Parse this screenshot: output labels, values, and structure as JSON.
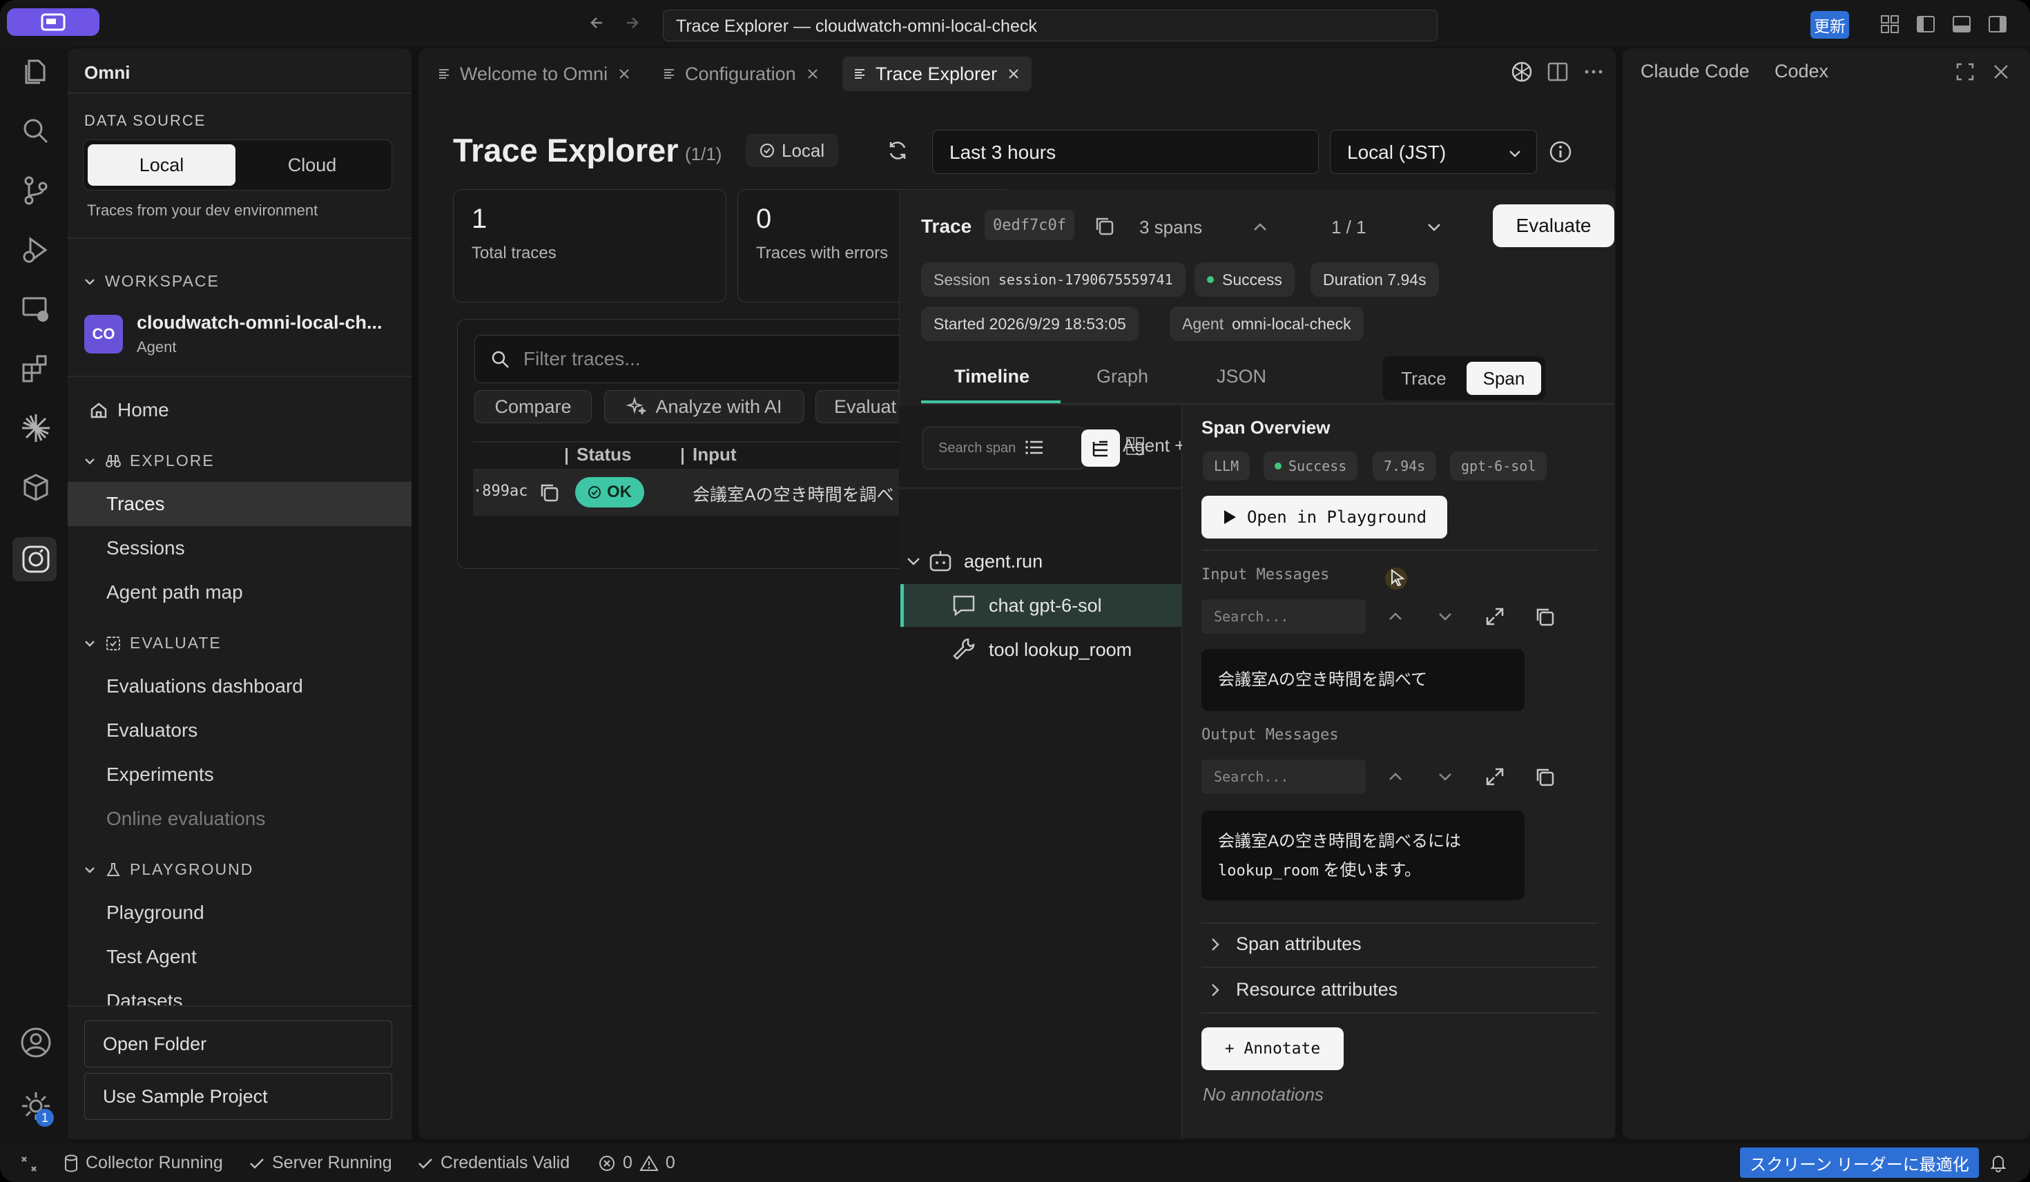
{
  "window": {
    "title": "Trace Explorer — cloudwatch-omni-local-check",
    "update_label": "更新"
  },
  "sidebar": {
    "app_name": "Omni",
    "data_source_heading": "DATA SOURCE",
    "local_label": "Local",
    "cloud_label": "Cloud",
    "data_source_hint": "Traces from your dev environment",
    "workspace_heading": "WORKSPACE",
    "workspace_avatar": "CO",
    "workspace_name": "cloudwatch-omni-local-ch...",
    "workspace_kind": "Agent",
    "home_label": "Home",
    "explore_heading": "EXPLORE",
    "explore_items": [
      "Traces",
      "Sessions",
      "Agent path map"
    ],
    "evaluate_heading": "EVALUATE",
    "evaluate_items": [
      "Evaluations dashboard",
      "Evaluators",
      "Experiments",
      "Online evaluations"
    ],
    "playground_heading": "PLAYGROUND",
    "playground_items": [
      "Playground",
      "Test Agent",
      "Datasets"
    ],
    "open_folder_label": "Open Folder",
    "sample_project_label": "Use Sample Project",
    "settings_badge": "1"
  },
  "tabs": [
    {
      "label": "Welcome to Omni"
    },
    {
      "label": "Configuration"
    },
    {
      "label": "Trace Explorer"
    }
  ],
  "explorer": {
    "title": "Trace Explorer",
    "count": "(1/1)",
    "local_badge": "Local",
    "time_range": "Last 3 hours",
    "timezone": "Local (JST)",
    "total_traces_value": "1",
    "total_traces_label": "Total traces",
    "errors_value": "0",
    "errors_label": "Traces with errors",
    "filter_placeholder": "Filter traces...",
    "compare_label": "Compare",
    "analyze_label": "Analyze with AI",
    "evaluate_partial": "Evaluat",
    "col_status": "Status",
    "col_input": "Input",
    "row_id": "·899ac",
    "row_status": "OK",
    "row_input": "会議室Aの空き時間を調べ"
  },
  "trace": {
    "label": "Trace",
    "id": "0edf7c0f",
    "spans": "3 spans",
    "pager": "1 / 1",
    "evaluate_label": "Evaluate",
    "session_key": "Session",
    "session_value": "session-1790675559741",
    "status": "Success",
    "duration": "Duration 7.94s",
    "started": "Started 2026/9/29 18:53:05",
    "agent_key": "Agent",
    "agent_value": "omni-local-check",
    "view_tabs": [
      "Timeline",
      "Graph",
      "JSON"
    ],
    "mode_trace": "Trace",
    "mode_span": "Span",
    "span_search_placeholder": "Search span",
    "agent_toggle_partial": "Agent +",
    "tree": [
      "agent.run",
      "chat gpt-6-sol",
      "tool lookup_room"
    ]
  },
  "span": {
    "overview_title": "Span Overview",
    "kind": "LLM",
    "status": "Success",
    "duration": "7.94s",
    "model": "gpt-6-sol",
    "playground_label": "Open in Playground",
    "input_heading": "Input Messages",
    "search_placeholder": "Search...",
    "input_message": "会議室Aの空き時間を調べて",
    "output_heading": "Output Messages",
    "output_line1": "会議室Aの空き時間を調べるには",
    "output_code": "lookup_room",
    "output_line2_rest": " を使います。",
    "span_attributes": "Span attributes",
    "resource_attributes": "Resource attributes",
    "annotate_label": "+ Annotate",
    "no_annotations": "No annotations"
  },
  "right_panel": {
    "tab1": "Claude Code",
    "tab2": "Codex"
  },
  "statusbar": {
    "collector": "Collector Running",
    "server": "Server Running",
    "credentials": "Credentials Valid",
    "errors": "0",
    "warnings": "0",
    "screen_reader": "スクリーン リーダーに最適化"
  },
  "colors": {
    "accent": "#6f55e6",
    "ok": "#3fc7a5",
    "success_dot": "#3fc77a",
    "update": "#2e6fd6"
  }
}
